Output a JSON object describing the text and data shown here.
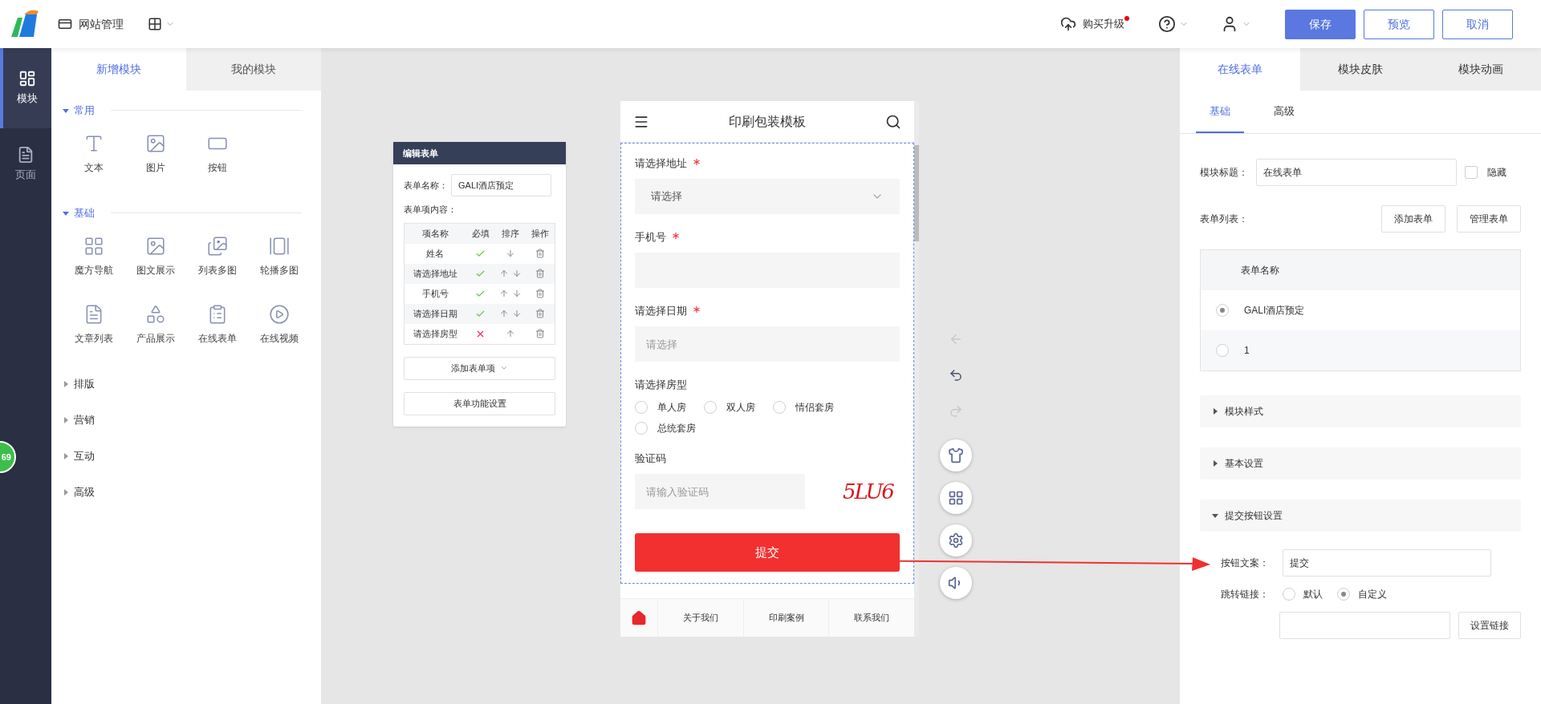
{
  "topbar": {
    "site_menu": "网站管理",
    "upgrade": "购买升级",
    "upgrade_notice": true,
    "actions": [
      {
        "label": "保存",
        "primary": true
      },
      {
        "label": "预览",
        "primary": false
      },
      {
        "label": "取消",
        "primary": false
      }
    ]
  },
  "nav": [
    {
      "label": "模块",
      "kind": "module",
      "selected": true
    },
    {
      "label": "页面",
      "kind": "page",
      "selected": false
    }
  ],
  "badge": "69",
  "module_tabs": [
    {
      "label": "新增模块",
      "selected": true
    },
    {
      "label": "我的模块",
      "selected": false
    }
  ],
  "groups": [
    {
      "title": "常用",
      "expanded": true,
      "items": [
        {
          "label": "文本",
          "kind": "text"
        },
        {
          "label": "图片",
          "kind": "image"
        },
        {
          "label": "按钮",
          "kind": "button"
        }
      ]
    },
    {
      "title": "基础",
      "expanded": true,
      "items": [
        {
          "label": "魔方导航",
          "kind": "grid"
        },
        {
          "label": "图文展示",
          "kind": "imagetext"
        },
        {
          "label": "列表多图",
          "kind": "imagelist"
        },
        {
          "label": "轮播多图",
          "kind": "carousel"
        },
        {
          "label": "文章列表",
          "kind": "article"
        },
        {
          "label": "产品展示",
          "kind": "product"
        },
        {
          "label": "在线表单",
          "kind": "form"
        },
        {
          "label": "在线视频",
          "kind": "video"
        }
      ]
    },
    {
      "title": "排版",
      "expanded": false
    },
    {
      "title": "营销",
      "expanded": false
    },
    {
      "title": "互动",
      "expanded": false
    },
    {
      "title": "高级",
      "expanded": false
    }
  ],
  "form_editor": {
    "title": "编辑表单",
    "name_label": "表单名称：",
    "name_value": "GALI酒店预定",
    "content_label": "表单项内容：",
    "columns": [
      "项名称",
      "必填",
      "排序",
      "操作"
    ],
    "rows": [
      {
        "name": "姓名",
        "required": true,
        "up": false,
        "down": true
      },
      {
        "name": "请选择地址",
        "required": true,
        "up": true,
        "down": true
      },
      {
        "name": "手机号",
        "required": true,
        "up": true,
        "down": true
      },
      {
        "name": "请选择日期",
        "required": true,
        "up": true,
        "down": true
      },
      {
        "name": "请选择房型",
        "required": false,
        "up": true,
        "down": false
      }
    ],
    "add_button": "添加表单项",
    "settings_button": "表单功能设置"
  },
  "phone": {
    "title": "印刷包装模板",
    "fields": [
      {
        "kind": "select",
        "label": "请选择地址",
        "required": true,
        "placeholder": "请选择"
      },
      {
        "kind": "input",
        "label": "手机号",
        "required": true
      },
      {
        "kind": "date",
        "label": "请选择日期",
        "required": true,
        "placeholder": "请选择"
      },
      {
        "kind": "radio",
        "label": "请选择房型",
        "required": false,
        "options": [
          {
            "label": "单人房",
            "selected": false
          },
          {
            "label": "双人房",
            "selected": false
          },
          {
            "label": "情侣套房",
            "selected": false
          },
          {
            "label": "总统套房",
            "selected": false
          }
        ]
      },
      {
        "kind": "captcha",
        "label": "验证码",
        "required": false,
        "placeholder": "请输入验证码",
        "code": "5LU6"
      }
    ],
    "submit": "提交",
    "bottom_nav": [
      "关于我们",
      "印刷案例",
      "联系我们"
    ]
  },
  "tools": [
    {
      "kind": "back",
      "disabled": true
    },
    {
      "kind": "undo",
      "disabled": false
    },
    {
      "kind": "redo",
      "disabled": true
    }
  ],
  "right_panel": {
    "tabs": [
      {
        "label": "在线表单",
        "selected": true
      },
      {
        "label": "模块皮肤",
        "selected": false
      },
      {
        "label": "模块动画",
        "selected": false
      }
    ],
    "subtabs": [
      {
        "label": "基础",
        "selected": true
      },
      {
        "label": "高级",
        "selected": false
      }
    ],
    "title_label": "模块标题：",
    "title_value": "在线表单",
    "hide_label": "隐藏",
    "hide_checked": false,
    "list_label": "表单列表：",
    "list_buttons": [
      "添加表单",
      "管理表单"
    ],
    "list_column": "表单名称",
    "forms": [
      {
        "name": "GALI酒店预定",
        "selected": true
      },
      {
        "name": "1",
        "selected": false
      }
    ],
    "sections": [
      {
        "title": "模块样式",
        "expanded": false
      },
      {
        "title": "基本设置",
        "expanded": false
      },
      {
        "title": "提交按钮设置",
        "expanded": true
      }
    ],
    "button_text_label": "按钮文案：",
    "button_text_value": "提交",
    "link_label": "跳转链接：",
    "link_options": [
      {
        "label": "默认",
        "selected": false
      },
      {
        "label": "自定义",
        "selected": true
      }
    ],
    "set_link": "设置链接"
  }
}
